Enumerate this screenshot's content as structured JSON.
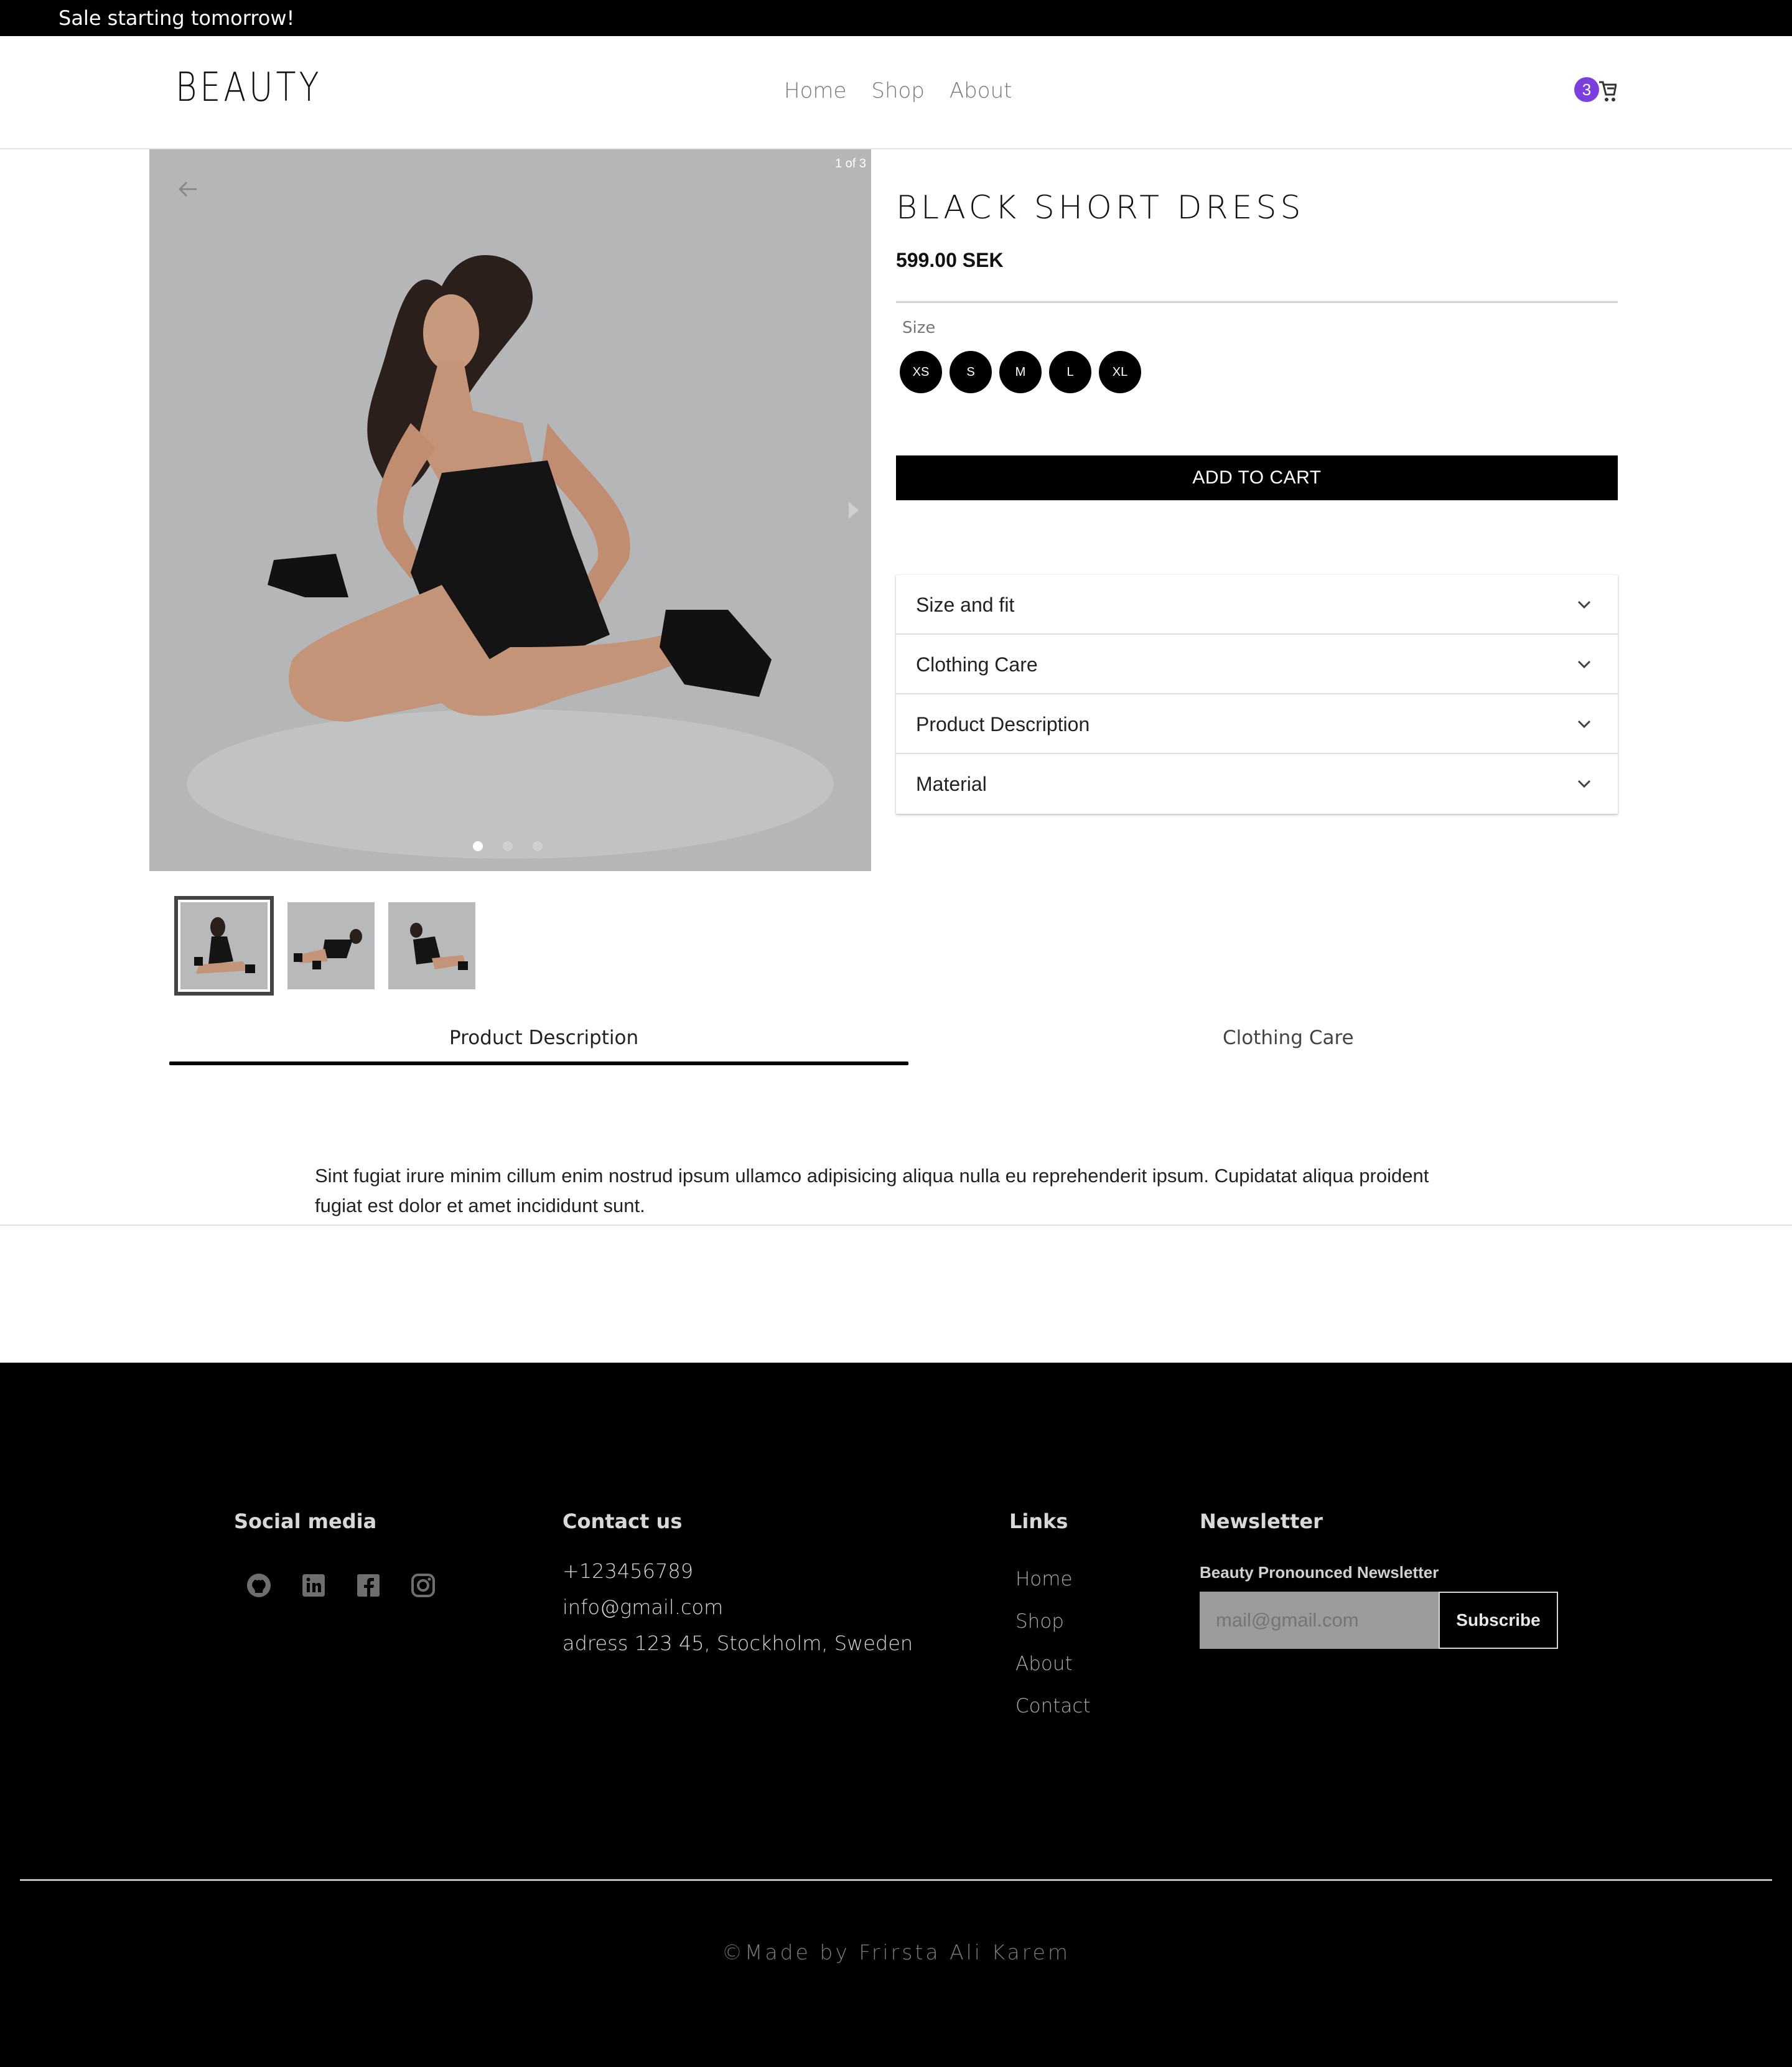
{
  "banner": {
    "text": "Sale starting tomorrow!"
  },
  "header": {
    "logo": "BEAUTY",
    "nav": [
      "Home",
      "Shop",
      "About"
    ],
    "cart_count": "3",
    "accent_color": "#7b3fe0"
  },
  "gallery": {
    "counter": "1 of 3",
    "current": 1,
    "total": 3,
    "dots": 3
  },
  "product": {
    "title": "BLACK SHORT DRESS",
    "price": "599.00 SEK",
    "size_label": "Size",
    "sizes": [
      "XS",
      "S",
      "M",
      "L",
      "XL"
    ],
    "add_to_cart": "ADD TO CART"
  },
  "accordion": [
    "Size and fit",
    "Clothing Care",
    "Product Description",
    "Material"
  ],
  "tabs": {
    "items": [
      "Product Description",
      "Clothing Care"
    ],
    "active": 0,
    "content": "Sint fugiat irure minim cillum enim nostrud ipsum ullamco adipisicing aliqua nulla eu reprehenderit ipsum. Cupidatat aliqua proident fugiat est dolor et amet incididunt sunt."
  },
  "footer": {
    "social_heading": "Social media",
    "social_icons": [
      "github-icon",
      "linkedin-icon",
      "facebook-icon",
      "instagram-icon"
    ],
    "contact_heading": "Contact us",
    "contact": [
      "+123456789",
      "info@gmail.com",
      "adress 123 45, Stockholm, Sweden"
    ],
    "links_heading": "Links",
    "links": [
      "Home",
      "Shop",
      "About",
      "Contact"
    ],
    "newsletter_heading": "Newsletter",
    "newsletter_label": "Beauty Pronounced Newsletter",
    "newsletter_placeholder": "mail@gmail.com",
    "subscribe": "Subscribe",
    "copyright": "©Made by Frirsta Ali Karem"
  }
}
